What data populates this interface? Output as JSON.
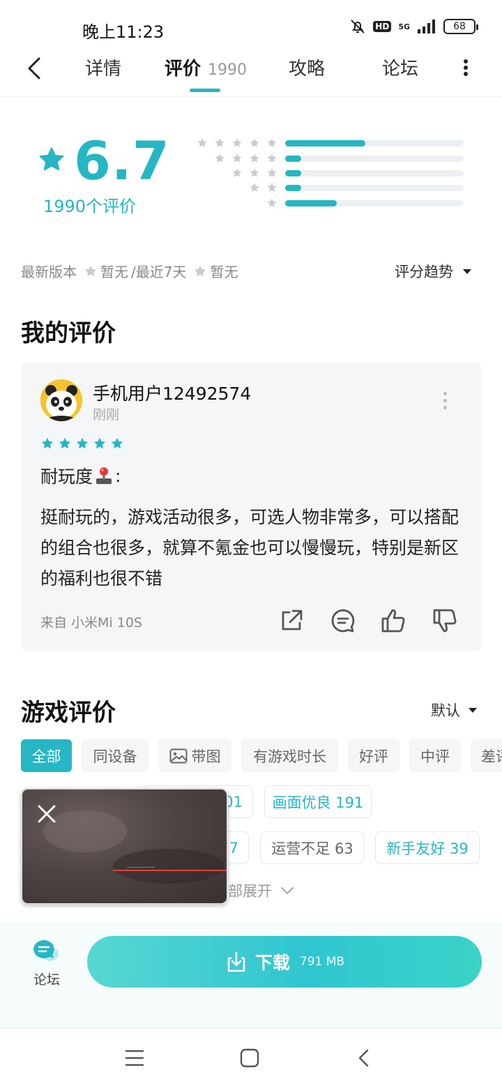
{
  "status_bar": {
    "time": "晚上11:23",
    "hd": "HD",
    "network": "5G",
    "battery": "68"
  },
  "top_nav": {
    "tabs": [
      {
        "label": "详情"
      },
      {
        "label": "评价",
        "count": "1990",
        "active": true
      },
      {
        "label": "攻略"
      },
      {
        "label": "论坛"
      }
    ]
  },
  "rating": {
    "score": "6.7",
    "count_label": "1990个评价",
    "distribution": [
      {
        "stars": 5,
        "fraction": 0.45
      },
      {
        "stars": 4,
        "fraction": 0.09
      },
      {
        "stars": 3,
        "fraction": 0.09
      },
      {
        "stars": 2,
        "fraction": 0.09
      },
      {
        "stars": 1,
        "fraction": 0.29
      }
    ],
    "latest_version_label": "最新版本",
    "latest_version_value": "暂无",
    "recent_label": "/最近7天",
    "recent_value": "暂无",
    "trend_label": "评分趋势"
  },
  "my_review": {
    "section_title": "我的评价",
    "username": "手机用户12492574",
    "time": "刚刚",
    "stars": 5,
    "subtitle": "耐玩度",
    "subtitle_suffix": ":",
    "text": "挺耐玩的，游戏活动很多，可选人物非常多，可以搭配的组合也很多，就算不氪金也可以慢慢玩，特别是新区的福利也很不错",
    "source": "来自 小米Mi 10S"
  },
  "game_reviews": {
    "section_title": "游戏评价",
    "sort_label": "默认",
    "filters": [
      "全部",
      "同设备",
      "带图",
      "有游戏时长",
      "好评",
      "中评",
      "差评"
    ],
    "tags_row1": [
      {
        "label": "01"
      },
      {
        "label": "画面优良 191"
      }
    ],
    "tags_row2": [
      {
        "label": "07"
      },
      {
        "label": "运营不足 63"
      },
      {
        "label": "新手友好 39"
      }
    ],
    "expand_label": "部展开"
  },
  "video": {
    "close_icon": "close-icon"
  },
  "bottom": {
    "forum_label": "论坛",
    "download_label": "下载",
    "download_size": "791 MB"
  },
  "colors": {
    "accent": "#26b6c4",
    "star_grey": "#c8ccd0"
  }
}
